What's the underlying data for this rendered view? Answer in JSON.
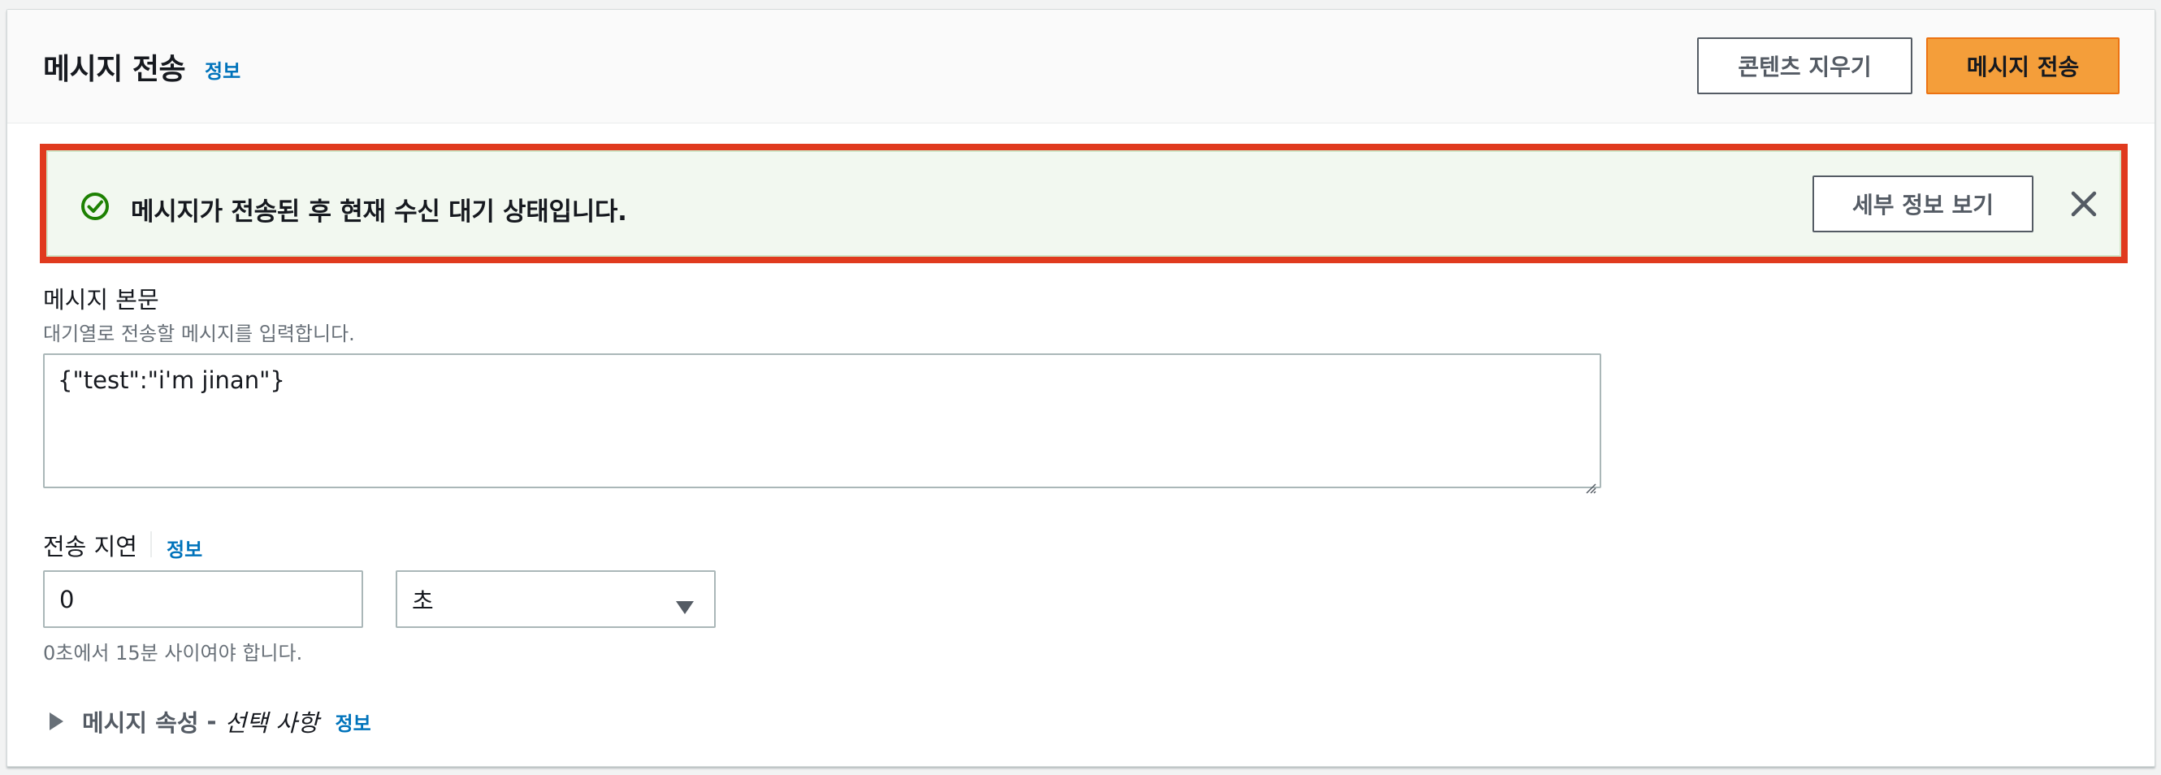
{
  "header": {
    "title": "메시지 전송",
    "info_label": "정보",
    "clear_button_label": "콘텐츠 지우기",
    "send_button_label": "메시지 전송"
  },
  "flash": {
    "type": "success",
    "message": "메시지가 전송된 후 현재 수신 대기 상태입니다.",
    "details_button_label": "세부 정보 보기",
    "icon": "check-circle-icon",
    "close_icon": "close-icon"
  },
  "message_body": {
    "label": "메시지 본문",
    "description": "대기열로 전송할 메시지를 입력합니다.",
    "value": "{\"test\":\"i'm jinan\"}"
  },
  "delivery_delay": {
    "label": "전송 지연",
    "info_label": "정보",
    "value": "0",
    "unit_selected": "초",
    "constraint": "0초에서 15분 사이여야 합니다."
  },
  "attributes_expander": {
    "title": "메시지 속성",
    "separator": "-",
    "optional_label": "선택 사항",
    "info_label": "정보",
    "expanded": false
  },
  "colors": {
    "primary_button": "#f49e3a",
    "link": "#0073bb",
    "success_icon": "#1d8102",
    "highlight_outline": "#e03a1e",
    "flash_background": "#f2f8f0"
  }
}
